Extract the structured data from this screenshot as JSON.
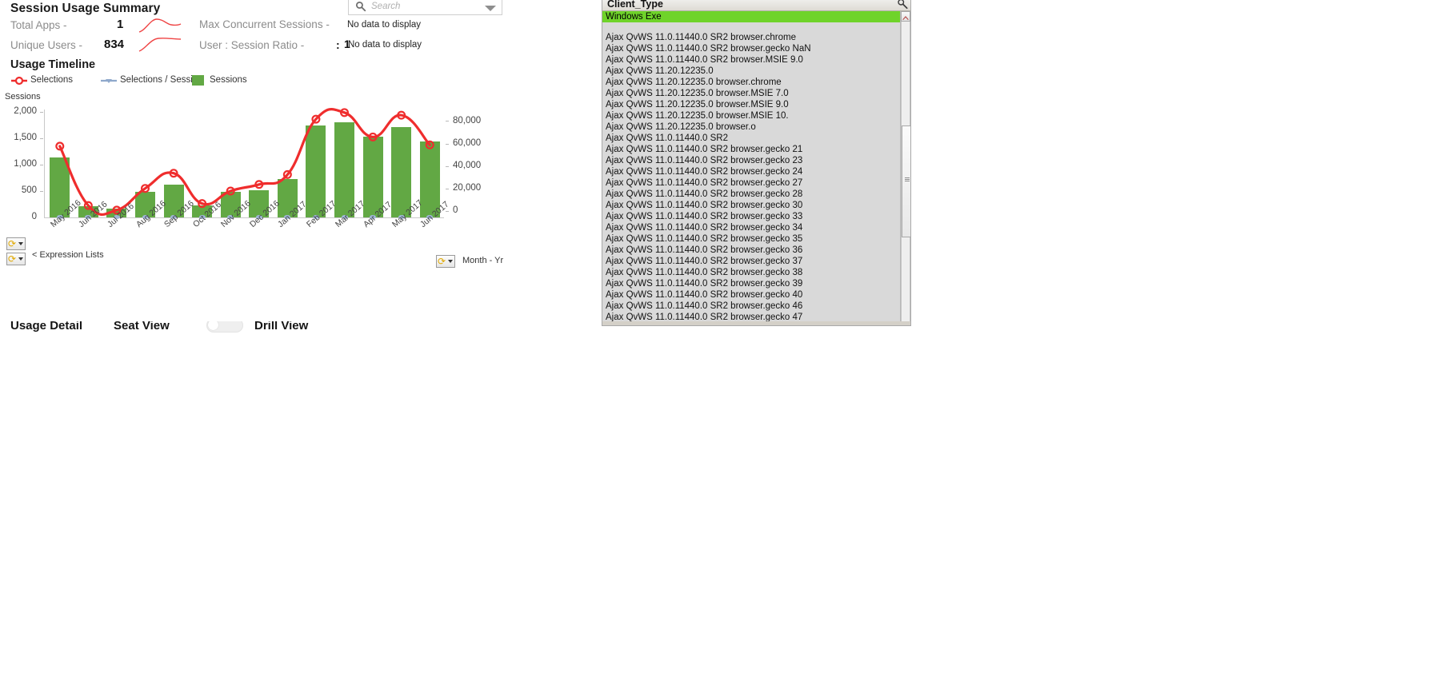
{
  "summary": {
    "title": "Session Usage Summary",
    "metrics": [
      {
        "label": "Total Apps -",
        "value": "1",
        "sparkline": "spark-total-apps"
      },
      {
        "label": "Unique Users -",
        "value": "834",
        "sparkline": "spark-unique-users"
      }
    ],
    "right_metrics": [
      {
        "label": "Max Concurrent Sessions -",
        "prefix": "",
        "value": "",
        "nodata": "No data to display"
      },
      {
        "label": "User : Session Ratio -",
        "prefix": ":",
        "value": "1",
        "nodata": "No data to display"
      }
    ]
  },
  "search": {
    "placeholder": "Search",
    "icon": "search-icon",
    "caret_icon": "chevron-down-icon"
  },
  "timeline": {
    "title": "Usage Timeline",
    "legend": [
      {
        "label": "Selections",
        "marker": "line-circle-marker",
        "color": "#ef2d2d"
      },
      {
        "label": "Selections / Session",
        "marker": "line-arrow-marker",
        "color": "#8fa9cc"
      },
      {
        "label": "Sessions",
        "marker": "square-marker",
        "color": "#62a844"
      }
    ],
    "controls": {
      "expression_lists": "< Expression Lists",
      "dimension_label": "Month - Yr",
      "cycle_icon": "cycle-refresh-icon"
    }
  },
  "chart_data": {
    "type": "bar",
    "title": "Usage Timeline",
    "xlabel": "",
    "ylabel": "Sessions",
    "categories": [
      "May 2016",
      "Jun 2016",
      "Jul 2016",
      "Aug 2016",
      "Sep 2016",
      "Oct 2016",
      "Nov 2016",
      "Dec 2016",
      "Jan 2017",
      "Feb 2017",
      "Mar 2017",
      "Apr 2017",
      "May 2017",
      "Jun 2017"
    ],
    "series": [
      {
        "name": "Sessions",
        "type": "bar",
        "color": "#62a844",
        "axis": "left",
        "values": [
          1130,
          210,
          165,
          480,
          615,
          220,
          485,
          520,
          720,
          1745,
          1810,
          1535,
          1715,
          1435
        ]
      },
      {
        "name": "Selections",
        "type": "line",
        "color": "#ef2d2d",
        "axis": "right",
        "values": [
          54000,
          9000,
          5500,
          22000,
          33500,
          10500,
          20000,
          25000,
          32500,
          74500,
          79500,
          61000,
          77500,
          55000
        ]
      },
      {
        "name": "Selections / Session",
        "type": "line",
        "color": "#9fb6d6",
        "axis": "left",
        "values": [
          20,
          20,
          20,
          20,
          20,
          20,
          20,
          20,
          20,
          20,
          20,
          20,
          20,
          20
        ]
      }
    ],
    "left_axis": {
      "label": "Sessions",
      "ticks": [
        "0",
        "500",
        "1,000",
        "1,500",
        "2,000"
      ],
      "min": 0,
      "max": 2000
    },
    "right_axis": {
      "label": "",
      "ticks": [
        "0",
        "20,000",
        "40,000",
        "60,000",
        "80,000"
      ],
      "min": 0,
      "max": 80000
    },
    "grid": false,
    "legend_position": "top-left"
  },
  "ghost": {
    "items": [
      "Usage Detail",
      "Seat View",
      "Drill View"
    ]
  },
  "listbox": {
    "title": "Client_Type",
    "search_icon": "magnifier-icon",
    "selected": "Windows Exe",
    "items": [
      "Ajax QvWS 11.0.11440.0 SR2 browser.chrome",
      "Ajax QvWS 11.0.11440.0 SR2 browser.gecko NaN",
      "Ajax QvWS 11.0.11440.0 SR2 browser.MSIE 9.0",
      "Ajax QvWS 11.20.12235.0",
      "Ajax QvWS 11.20.12235.0 browser.chrome",
      "Ajax QvWS 11.20.12235.0 browser.MSIE 7.0",
      "Ajax QvWS 11.20.12235.0 browser.MSIE 9.0",
      "Ajax QvWS 11.20.12235.0 browser.MSIE 10.",
      "Ajax QvWS 11.20.12235.0 browser.o",
      "Ajax QvWS 11.0.11440.0 SR2",
      "Ajax QvWS 11.0.11440.0 SR2 browser.gecko 21",
      "Ajax QvWS 11.0.11440.0 SR2 browser.gecko 23",
      "Ajax QvWS 11.0.11440.0 SR2 browser.gecko 24",
      "Ajax QvWS 11.0.11440.0 SR2 browser.gecko 27",
      "Ajax QvWS 11.0.11440.0 SR2 browser.gecko 28",
      "Ajax QvWS 11.0.11440.0 SR2 browser.gecko 30",
      "Ajax QvWS 11.0.11440.0 SR2 browser.gecko 33",
      "Ajax QvWS 11.0.11440.0 SR2 browser.gecko 34",
      "Ajax QvWS 11.0.11440.0 SR2 browser.gecko 35",
      "Ajax QvWS 11.0.11440.0 SR2 browser.gecko 36",
      "Ajax QvWS 11.0.11440.0 SR2 browser.gecko 37",
      "Ajax QvWS 11.0.11440.0 SR2 browser.gecko 38",
      "Ajax QvWS 11.0.11440.0 SR2 browser.gecko 39",
      "Ajax QvWS 11.0.11440.0 SR2 browser.gecko 40",
      "Ajax QvWS 11.0.11440.0 SR2 browser.gecko 46",
      "Ajax QvWS 11.0.11440.0 SR2 browser.gecko 47"
    ]
  },
  "colors": {
    "bar_green": "#62a844",
    "line_red": "#ef2d2d",
    "line_blue": "#9fb6d6",
    "selection_green": "#6fd32a",
    "panel_grey": "#d9d9d9"
  }
}
